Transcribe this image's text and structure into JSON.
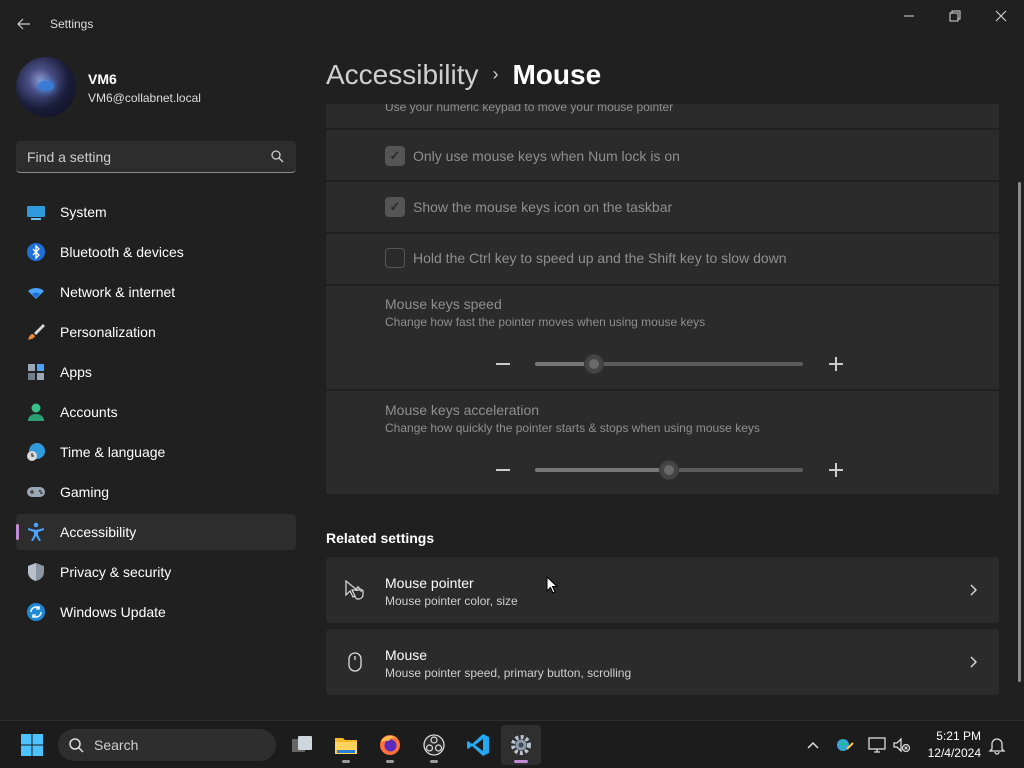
{
  "window": {
    "title": "Settings",
    "back_icon": "back-arrow-icon",
    "controls": [
      "minimize-icon",
      "restore-icon",
      "close-icon"
    ]
  },
  "profile": {
    "name": "VM6",
    "email": "VM6@collabnet.local"
  },
  "search": {
    "placeholder": "Find a setting"
  },
  "sidebar": {
    "items": [
      {
        "label": "System",
        "icon": "system-icon"
      },
      {
        "label": "Bluetooth & devices",
        "icon": "bluetooth-icon"
      },
      {
        "label": "Network & internet",
        "icon": "wifi-icon"
      },
      {
        "label": "Personalization",
        "icon": "brush-icon"
      },
      {
        "label": "Apps",
        "icon": "apps-icon"
      },
      {
        "label": "Accounts",
        "icon": "person-icon"
      },
      {
        "label": "Time & language",
        "icon": "globe-clock-icon"
      },
      {
        "label": "Gaming",
        "icon": "gamepad-icon"
      },
      {
        "label": "Accessibility",
        "icon": "accessibility-icon",
        "active": true
      },
      {
        "label": "Privacy & security",
        "icon": "shield-icon"
      },
      {
        "label": "Windows Update",
        "icon": "update-icon"
      }
    ]
  },
  "breadcrumb": {
    "parent": "Accessibility",
    "separator": "›",
    "current": "Mouse"
  },
  "mouse_keys": {
    "numeric_keypad_desc": "Use your numeric keypad to move your mouse pointer",
    "numlock_only": {
      "label": "Only use mouse keys when Num lock is on",
      "checked": true
    },
    "taskbar_icon": {
      "label": "Show the mouse keys icon on the taskbar",
      "checked": true
    },
    "ctrl_shift": {
      "label": "Hold the Ctrl key to speed up and the Shift key to slow down",
      "checked": false
    },
    "speed": {
      "label": "Mouse keys speed",
      "description": "Change how fast the pointer moves when using mouse keys",
      "value": 0.22
    },
    "acceleration": {
      "label": "Mouse keys acceleration",
      "description": "Change how quickly the pointer starts & stops when using mouse keys",
      "value": 0.5
    }
  },
  "related": {
    "title": "Related settings",
    "items": [
      {
        "label": "Mouse pointer",
        "description": "Mouse pointer color, size",
        "icon": "mouse-pointer-icon"
      },
      {
        "label": "Mouse",
        "description": "Mouse pointer speed, primary button, scrolling",
        "icon": "mouse-icon"
      }
    ]
  },
  "taskbar": {
    "search_label": "Search",
    "apps": [
      "task-view-icon",
      "file-explorer-icon",
      "firefox-icon",
      "obs-icon",
      "vscode-icon",
      "settings-icon"
    ],
    "time": "5:21 PM",
    "date": "12/4/2024"
  },
  "colors": {
    "accent": "#c28bd8",
    "background": "#202020",
    "card": "#2b2b2b"
  }
}
